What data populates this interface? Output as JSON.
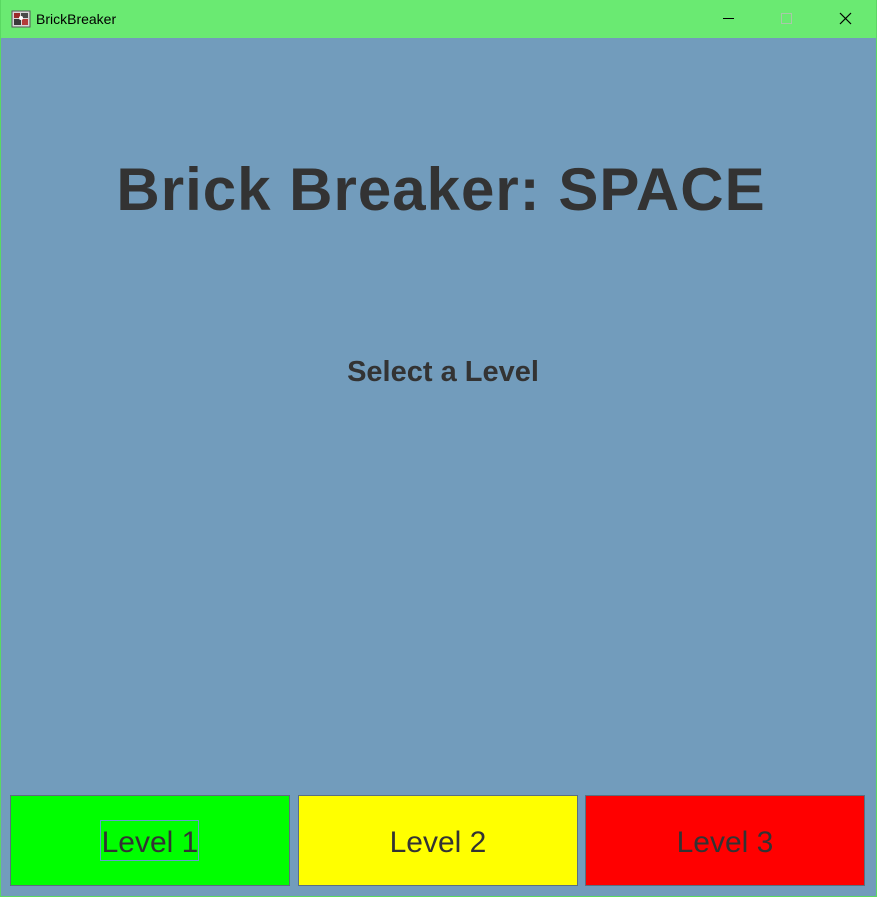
{
  "window": {
    "title": "BrickBreaker",
    "icon": "brickbreaker-app-icon",
    "controls": {
      "minimize_icon": "minimize-icon",
      "maximize_icon": "maximize-icon",
      "close_icon": "close-icon"
    }
  },
  "menu": {
    "title": "Brick Breaker: SPACE",
    "subtitle": "Select a Level",
    "background_color": "#729cbc",
    "levels": [
      {
        "label": "Level 1",
        "color": "#00ff00",
        "focused": true
      },
      {
        "label": "Level 2",
        "color": "#ffff00",
        "focused": false
      },
      {
        "label": "Level 3",
        "color": "#ff0000",
        "focused": false
      }
    ]
  }
}
